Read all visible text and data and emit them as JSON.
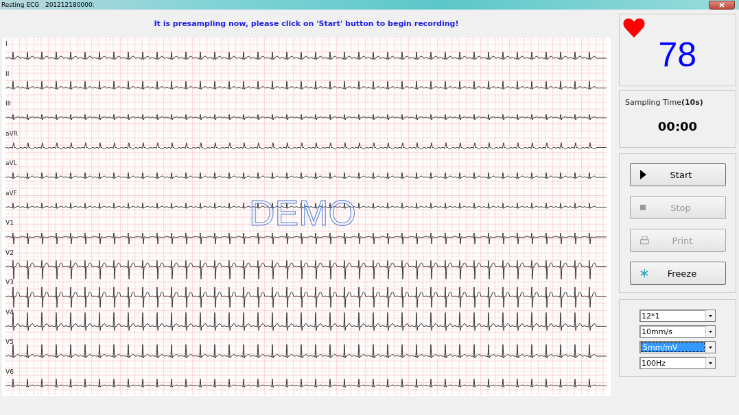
{
  "window": {
    "title": "Resting ECG   201212180000:"
  },
  "message": "It is presampling now, please click on 'Start' button to begin recording!",
  "ecg": {
    "overlay_text": "DEMO",
    "leads": [
      {
        "name": "I"
      },
      {
        "name": "II"
      },
      {
        "name": "III"
      },
      {
        "name": "aVR"
      },
      {
        "name": "aVL"
      },
      {
        "name": "aVF"
      },
      {
        "name": "V1"
      },
      {
        "name": "V2"
      },
      {
        "name": "V3"
      },
      {
        "name": "V4"
      },
      {
        "name": "V5"
      },
      {
        "name": "V6"
      }
    ]
  },
  "heart_rate": "78",
  "sampling": {
    "label": "Sampling Time**(10s)**",
    "time": "00:00"
  },
  "buttons": [
    {
      "label": "Start",
      "kind": "play",
      "disabled": false
    },
    {
      "label": "Stop",
      "kind": "stop",
      "disabled": true
    },
    {
      "label": "Print",
      "kind": "print",
      "disabled": true
    },
    {
      "label": "Freeze",
      "kind": "freeze",
      "disabled": false
    }
  ],
  "dropdowns": [
    {
      "value": "12*1",
      "selected": false
    },
    {
      "value": "10mm/s",
      "selected": false
    },
    {
      "value": "5mm/mV",
      "selected": true
    },
    {
      "value": "100Hz",
      "selected": false
    }
  ]
}
